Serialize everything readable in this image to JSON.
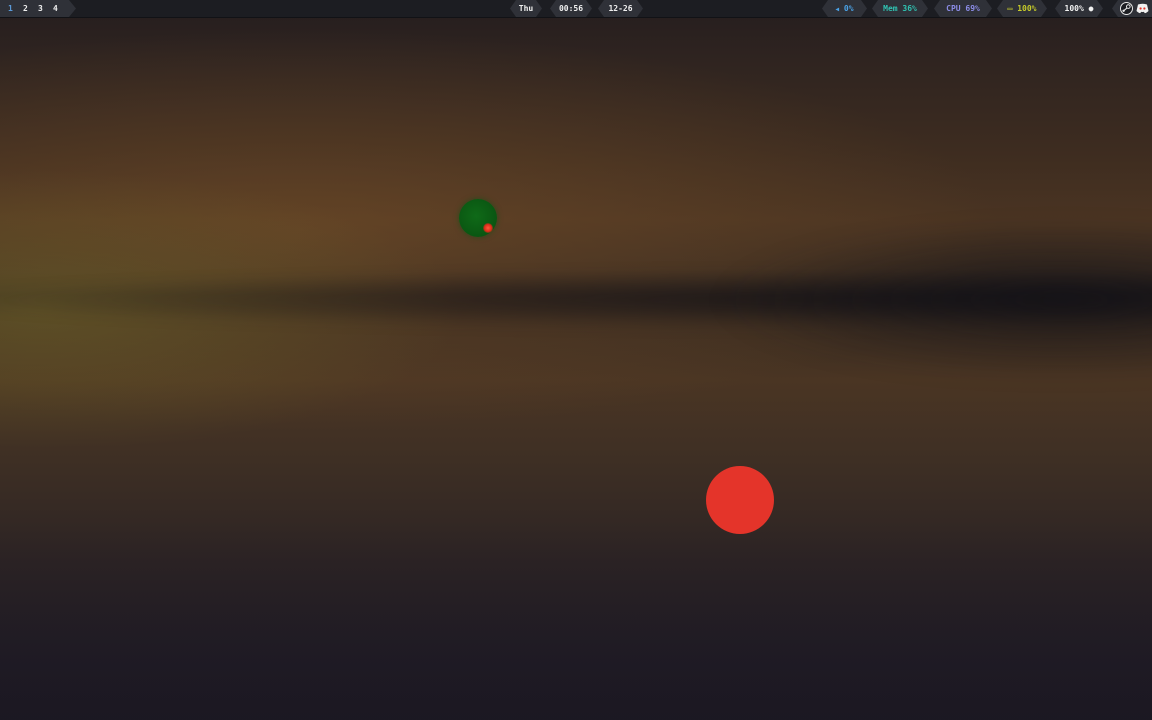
{
  "panel": {
    "workspaces": [
      {
        "label": "1",
        "active": true
      },
      {
        "label": "2",
        "active": false
      },
      {
        "label": "3",
        "active": false
      },
      {
        "label": "4",
        "active": false
      }
    ],
    "clock": {
      "day": "Thu",
      "time": "00:56",
      "date": "12-26"
    },
    "status": {
      "volume": {
        "icon": "speaker-icon",
        "glyph": "◀",
        "text": "0%",
        "color": "#4aa3e8"
      },
      "memory": {
        "text": "Mem 36%",
        "color": "#30c0b0"
      },
      "cpu": {
        "text": "CPU 69%",
        "color": "#8b8ce6"
      },
      "battery": {
        "icon": "battery-icon",
        "glyph": "▭",
        "text": "100%",
        "color": "#c7cc2a"
      },
      "brightness": {
        "icon": "brightness-icon",
        "glyph": "●",
        "text": "100%",
        "color": "#f2f2f2"
      }
    },
    "tray": [
      {
        "icon": "steam-icon"
      },
      {
        "icon": "discord-icon"
      }
    ],
    "active_workspace_color": "#5b9ad8"
  },
  "wallpaper": {
    "colors": {
      "top": "#241d1e",
      "mid": "#4a3422",
      "bottom": "#1e1a22",
      "green_orb": "#0a5612",
      "red_orb": "#e4342a"
    }
  }
}
